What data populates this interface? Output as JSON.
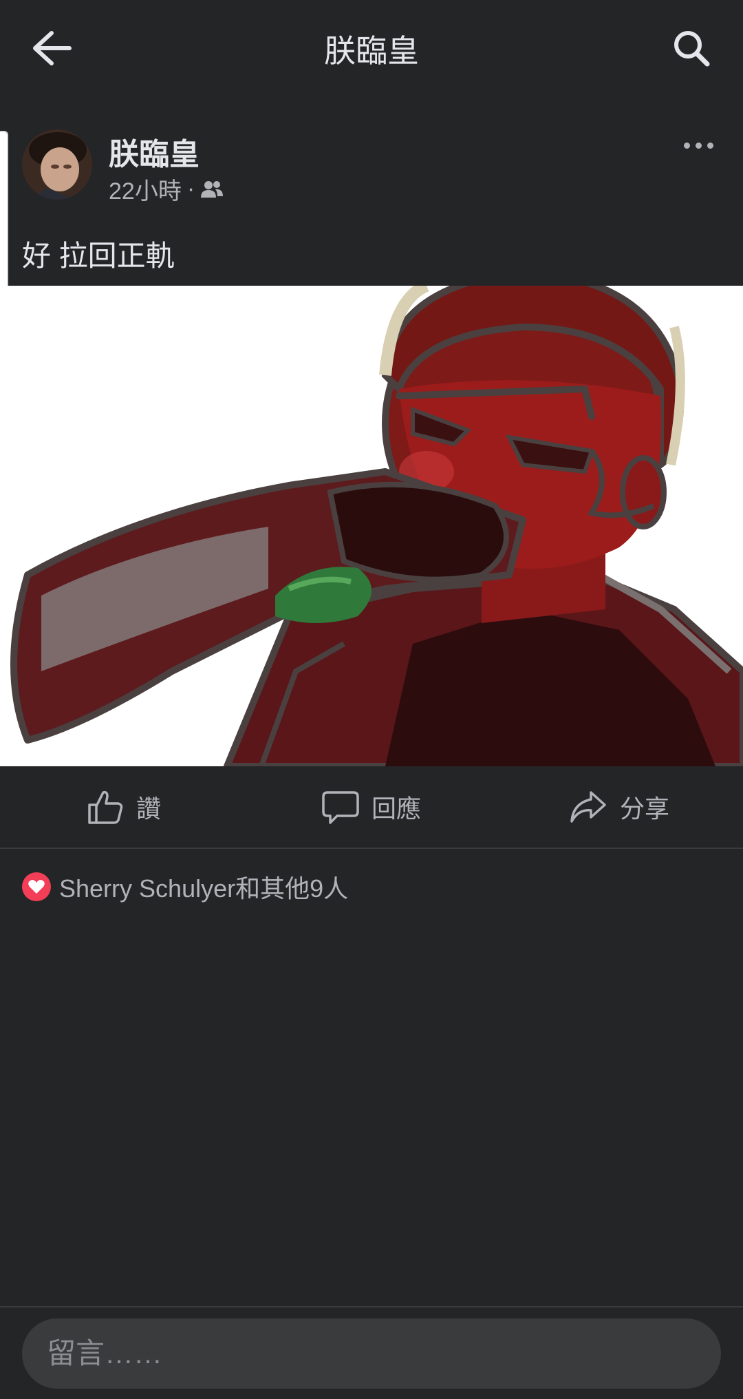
{
  "header": {
    "title": "朕臨皇",
    "back_icon": "arrow-left-icon",
    "search_icon": "search-icon"
  },
  "post": {
    "author": "朕臨皇",
    "time": "22小時",
    "separator": "·",
    "audience_icon": "friends-icon",
    "text": "好 拉回正軌"
  },
  "actions": {
    "like_label": "讚",
    "comment_label": "回應",
    "share_label": "分享"
  },
  "reactions": {
    "icon": "heart-icon",
    "summary": "Sherry Schulyer和其他9人"
  },
  "comment": {
    "placeholder": "留言……"
  },
  "colors": {
    "background": "#242527",
    "heart": "#f33e58",
    "text_primary": "#e4e6eb",
    "text_secondary": "#b0b3b8"
  }
}
